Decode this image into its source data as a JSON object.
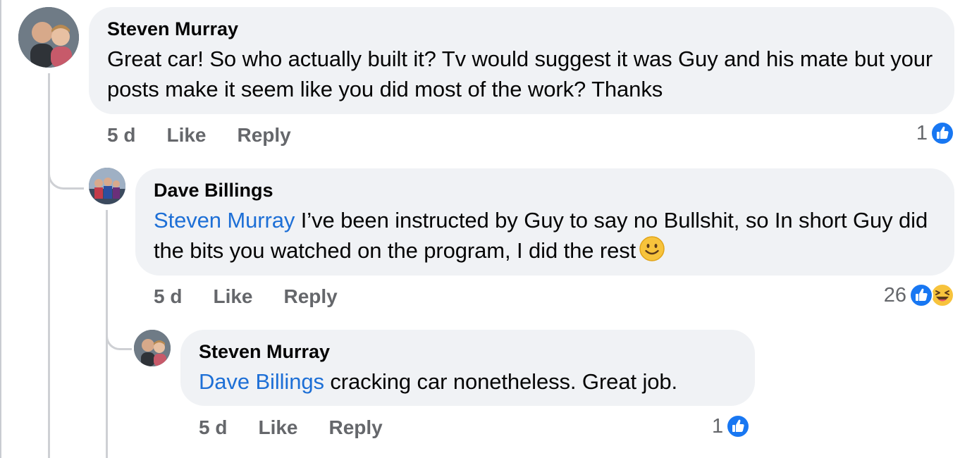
{
  "comments": [
    {
      "author": "Steven Murray",
      "text": "Great car! So who actually built it? Tv would suggest it was Guy and his mate but your posts make it seem like you did most of the work? Thanks",
      "time": "5 d",
      "like_label": "Like",
      "reply_label": "Reply",
      "reaction_count": "1",
      "reactions": [
        "like-icon"
      ]
    },
    {
      "author": "Dave Billings",
      "mention": "Steven Murray",
      "text": " I’ve been instructed by Guy to say no Bullshit, so In short Guy did the bits you watched on the program, I did the rest",
      "trailing_emoji": "smiley-emoji",
      "time": "5 d",
      "like_label": "Like",
      "reply_label": "Reply",
      "reaction_count": "26",
      "reactions": [
        "like-icon",
        "haha-icon"
      ]
    },
    {
      "author": "Steven Murray",
      "mention": "Dave Billings",
      "text": " cracking car nonetheless. Great job.",
      "time": "5 d",
      "like_label": "Like",
      "reply_label": "Reply",
      "reaction_count": "1",
      "reactions": [
        "like-icon"
      ]
    }
  ],
  "colors": {
    "bubble": "#f0f2f5",
    "mention": "#1d6fd6",
    "like_blue": "#1877f2",
    "secondary_text": "#65676b"
  }
}
